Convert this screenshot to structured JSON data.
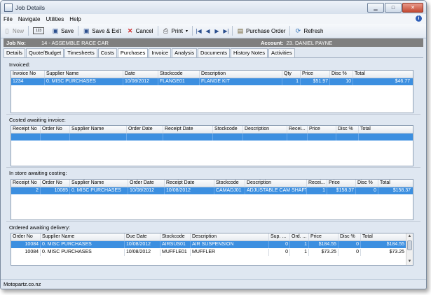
{
  "window": {
    "title": "Job Details"
  },
  "menu": [
    "File",
    "Navigate",
    "Utilities",
    "Help"
  ],
  "toolbar": {
    "new": "New",
    "save": "Save",
    "save_exit": "Save & Exit",
    "cancel": "Cancel",
    "print": "Print",
    "purchase_order": "Purchase Order",
    "refresh": "Refresh"
  },
  "job": {
    "job_label": "Job No:",
    "job_value": "14 - ASSEMBLE RACE CAR",
    "account_label": "Account:",
    "account_value": "23. DANIEL PAYNE"
  },
  "tabs": [
    "Details",
    "Quote/Budget",
    "Timesheets",
    "Costs",
    "Purchases",
    "Invoice",
    "Analysis",
    "Documents",
    "History Notes",
    "Activities"
  ],
  "active_tab": "Purchases",
  "sections": {
    "invoiced": {
      "label": "Invoiced:",
      "columns": [
        "Invoice No",
        "Supplier Name",
        "Date",
        "Stockcode",
        "Description",
        "Qty",
        "Price",
        "Disc %",
        "Total"
      ],
      "rows": [
        [
          "1234",
          "0. MISC PURCHASES",
          "10/08/2012",
          "FLANGE01",
          "FLANGE KIT",
          "1",
          "$51.97",
          "10",
          "$46.77"
        ]
      ]
    },
    "costed": {
      "label": "Costed awaiting invoice:",
      "columns": [
        "Receipt No",
        "Order No",
        "Supplier Name",
        "Order Date",
        "Receipt Date",
        "Stockcode",
        "Description",
        "Recei...",
        "Price",
        "Disc %",
        "Total"
      ],
      "rows": [
        [
          "",
          "",
          "",
          "",
          "",
          "",
          "",
          "",
          "",
          "",
          ""
        ]
      ]
    },
    "instore": {
      "label": "In store awaiting costing:",
      "columns": [
        "Receipt No",
        "Order No",
        "Supplier Name",
        "Order Date",
        "Receipt Date",
        "Stockcode",
        "Description",
        "Recei...",
        "Price",
        "Disc %",
        "Total"
      ],
      "rows": [
        [
          "2",
          "10085",
          "0. MISC PURCHASES",
          "10/08/2012",
          "10/08/2012",
          "CAMADJ01",
          "ADJUSTABLE CAM SHAFT",
          "1",
          "$158.37",
          "0",
          "$158.37"
        ]
      ]
    },
    "ordered": {
      "label": "Ordered awaiting delivery:",
      "columns": [
        "Order No",
        "Supplier Name",
        "Due Date",
        "Stockcode",
        "Description",
        "Sup. ...",
        "Ord. ...",
        "Price",
        "Disc %",
        "Total"
      ],
      "rows": [
        [
          "10084",
          "0. MISC PURCHASES",
          "10/08/2012",
          "AIRSUS01",
          "AIR SUSPENSION",
          "0",
          "1",
          "$184.55",
          "0",
          "$184.55"
        ],
        [
          "10084",
          "0. MISC PURCHASES",
          "10/08/2012",
          "MUFFLE01",
          "MUFFLER",
          "0",
          "1",
          "$73.25",
          "0",
          "$73.25"
        ]
      ]
    }
  },
  "status": {
    "text": "Motopartz.co.nz"
  },
  "colors": {
    "selection": "#3c8fe0",
    "jobbar": "#7f7f7f"
  }
}
